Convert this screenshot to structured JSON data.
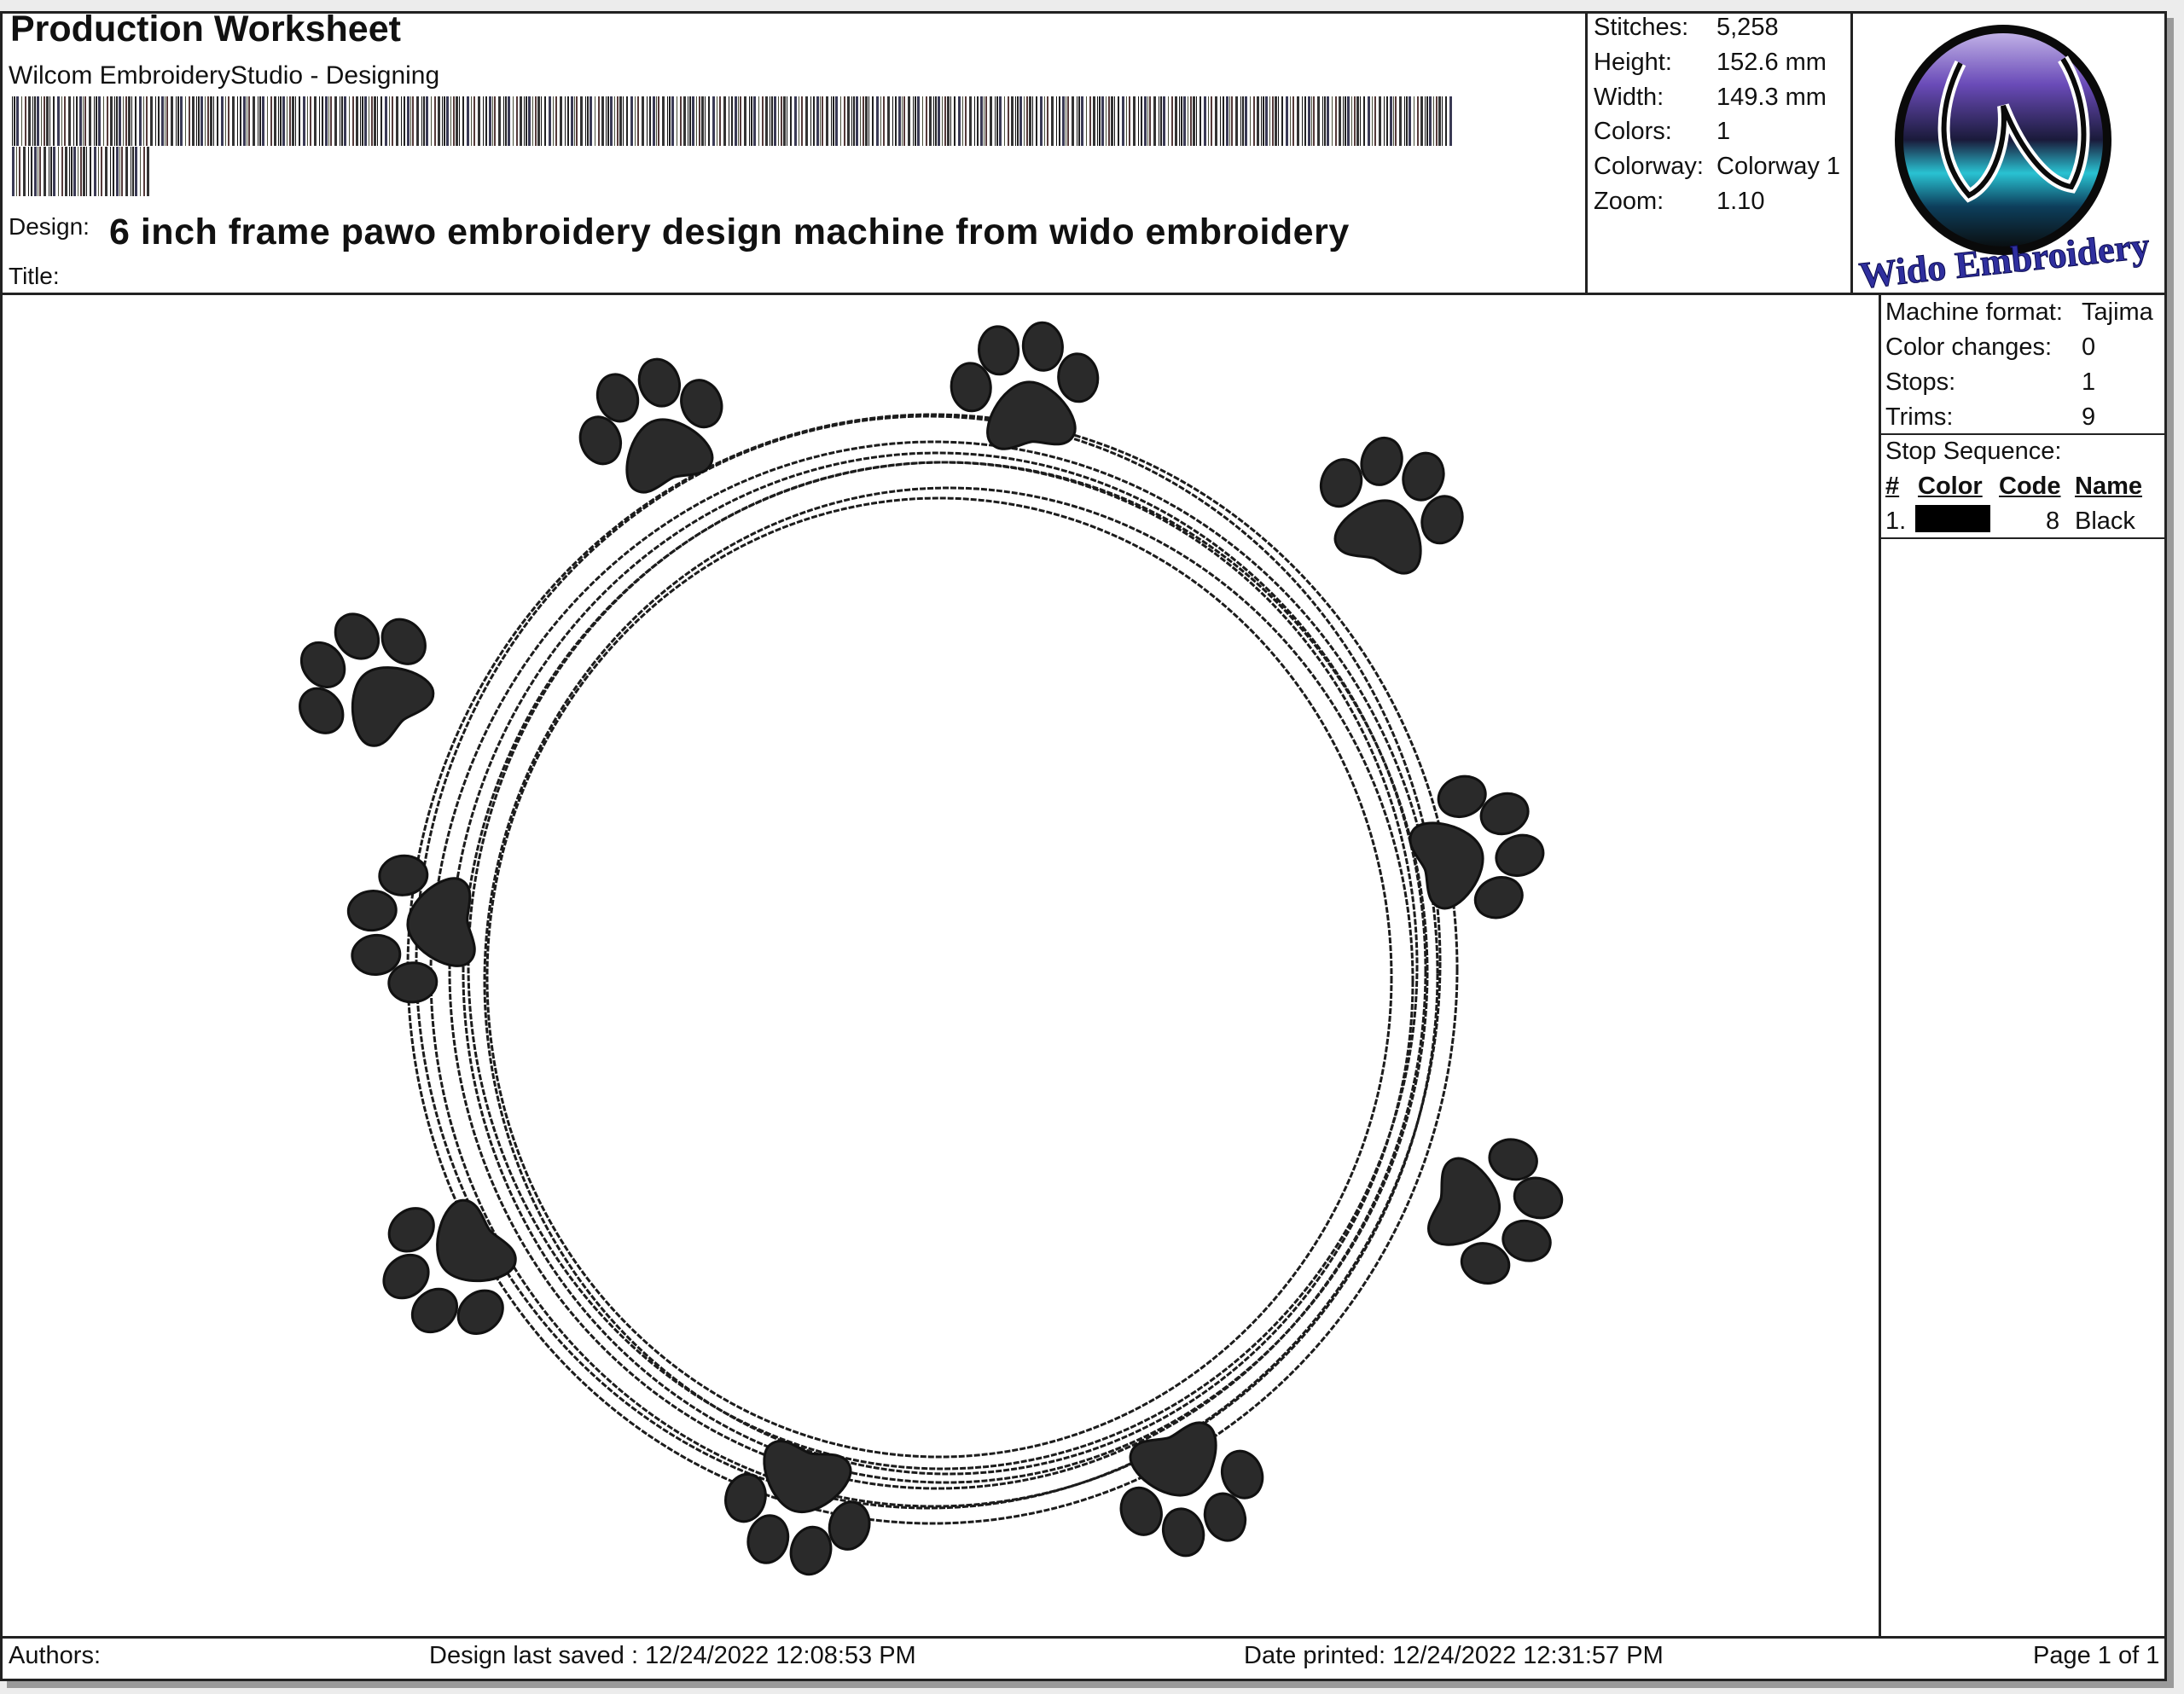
{
  "header": {
    "title": "Production Worksheet",
    "subtitle": "Wilcom EmbroideryStudio - Designing",
    "design_label": "Design:",
    "design_value": "6 inch frame pawo embroidery design machine from wido embroidery",
    "title_label": "Title:",
    "title_value": ""
  },
  "stats": [
    {
      "label": "Stitches:",
      "value": "5,258"
    },
    {
      "label": "Height:",
      "value": "152.6 mm"
    },
    {
      "label": "Width:",
      "value": "149.3 mm"
    },
    {
      "label": "Colors:",
      "value": "1"
    },
    {
      "label": "Colorway:",
      "value": "Colorway 1"
    },
    {
      "label": "Zoom:",
      "value": "1.10"
    }
  ],
  "logo": {
    "text": "Wido Embroidery"
  },
  "machine_info": [
    {
      "label": "Machine format:",
      "value": "Tajima"
    },
    {
      "label": "Color changes:",
      "value": "0"
    },
    {
      "label": "Stops:",
      "value": "1"
    },
    {
      "label": "Trims:",
      "value": "9"
    }
  ],
  "stop_sequence": {
    "label": "Stop Sequence:",
    "headers": {
      "num": "#",
      "color": "Color",
      "code": "Code",
      "name": "Name"
    },
    "rows": [
      {
        "num": "1.",
        "color": "#000000",
        "code": "8",
        "name": "Black"
      }
    ]
  },
  "footer": {
    "authors": "Authors:",
    "saved": "Design last saved : 12/24/2022 12:08:53 PM",
    "printed": "Date printed: 12/24/2022 12:31:57 PM",
    "page": "Page 1 of 1"
  },
  "colors": {
    "thread": "#1c1c1c",
    "paw_fill": "#2a2a2a",
    "border": "#222222"
  }
}
